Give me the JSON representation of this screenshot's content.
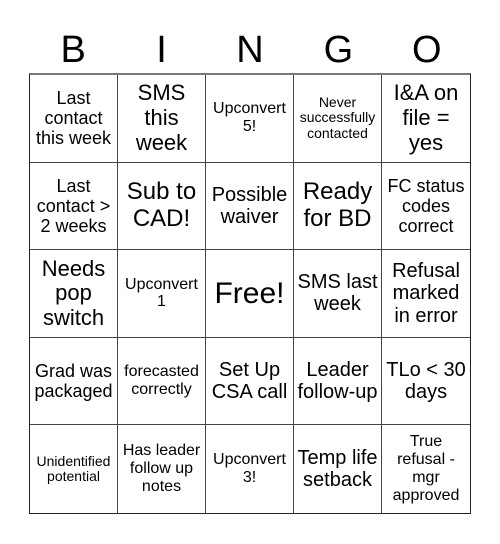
{
  "title_letters": [
    "B",
    "I",
    "N",
    "G",
    "O"
  ],
  "cells": [
    [
      "Last contact this week",
      "SMS this week",
      "Upconvert 5!",
      "Never successfully contacted",
      "I&A on file = yes"
    ],
    [
      "Last contact > 2 weeks",
      "Sub to CAD!",
      "Possible waiver",
      "Ready for BD",
      "FC status codes correct"
    ],
    [
      "Needs pop switch",
      "Upconvert 1",
      "Free!",
      "SMS last week",
      "Refusal marked in error"
    ],
    [
      "Grad was packaged",
      "forecasted correctly",
      "Set Up CSA call",
      "Leader follow-up",
      "TLo < 30 days"
    ],
    [
      "Unidentified potential",
      "Has leader follow up notes",
      "Upconvert 3!",
      "Temp life setback",
      "True refusal - mgr approved"
    ]
  ]
}
